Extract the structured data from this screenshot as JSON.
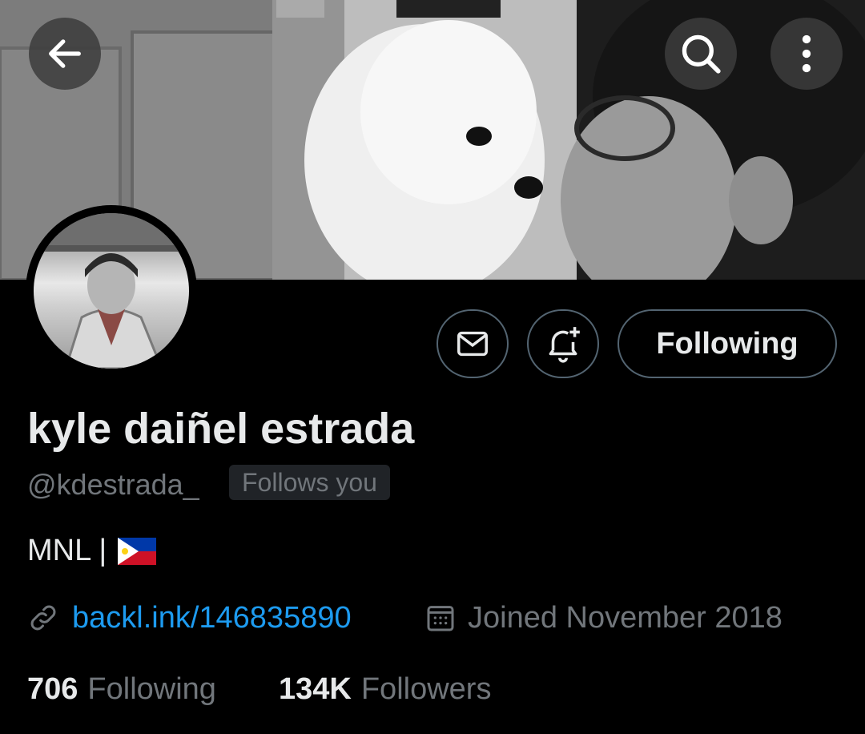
{
  "header": {
    "back_icon": "arrow-left-icon",
    "search_icon": "search-icon",
    "more_icon": "more-vertical-icon"
  },
  "profile": {
    "name": "kyle daiñel estrada",
    "handle": "@kdestrada_",
    "follows_you": "Follows you",
    "bio": "MNL |",
    "bio_flag": "philippines-flag-icon",
    "link": "backl.ink/146835890",
    "joined": "Joined November 2018"
  },
  "actions": {
    "message_icon": "mail-icon",
    "notify_icon": "bell-plus-icon",
    "following_label": "Following"
  },
  "stats": {
    "following_count": "706",
    "following_label": "Following",
    "followers_count": "134K",
    "followers_label": "Followers"
  },
  "colors": {
    "background": "#000000",
    "primary_text": "#e7e9ea",
    "secondary_text": "#71767b",
    "link": "#1d9bf0",
    "border": "#536471",
    "badge_bg": "#202327"
  }
}
